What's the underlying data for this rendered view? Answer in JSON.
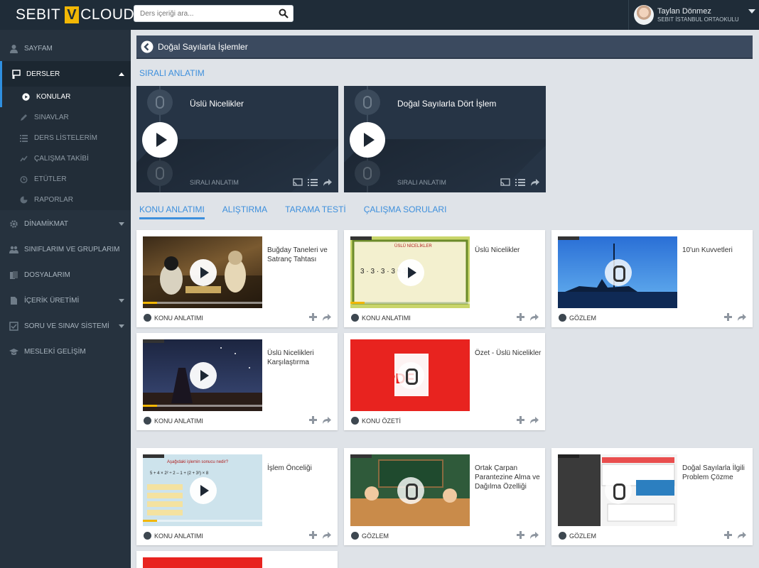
{
  "brand": {
    "left": "SEBIT",
    "v": "V",
    "right": "CLOUD"
  },
  "search": {
    "placeholder": "Ders içeriği ara..."
  },
  "user": {
    "name": "Taylan Dönmez",
    "school": "SEBIT İSTANBUL ORTAOKULU"
  },
  "sidebar": {
    "items": [
      {
        "label": "SAYFAM",
        "icon": "user-icon"
      },
      {
        "label": "DERSLER",
        "icon": "presentation-icon"
      },
      {
        "label": "DİNAMİKMAT",
        "icon": "gear-icon"
      },
      {
        "label": "SINIFLARIM VE GRUPLARIM",
        "icon": "group-icon"
      },
      {
        "label": "DOSYALARIM",
        "icon": "files-icon"
      },
      {
        "label": "İÇERİK ÜRETİMİ",
        "icon": "document-icon"
      },
      {
        "label": "SORU VE SINAV SİSTEMİ",
        "icon": "exam-icon"
      },
      {
        "label": "MESLEKİ GELİŞİM",
        "icon": "graduation-cap-icon"
      }
    ],
    "subitems": [
      {
        "label": "KONULAR",
        "icon": "play-circle-icon"
      },
      {
        "label": "SINAVLAR",
        "icon": "pencil-icon"
      },
      {
        "label": "DERS LİSTELERİM",
        "icon": "list-icon"
      },
      {
        "label": "ÇALIŞMA TAKİBİ",
        "icon": "tracking-icon"
      },
      {
        "label": "ETÜTLER",
        "icon": "clock-icon"
      },
      {
        "label": "RAPORLAR",
        "icon": "pie-chart-icon"
      }
    ]
  },
  "breadcrumb": {
    "title": "Doğal Sayılarla İşlemler"
  },
  "sequential": {
    "heading": "SIRALI ANLATIM",
    "cards": [
      {
        "title": "Üslü Nicelikler",
        "kind": "SIRALI ANLATIM"
      },
      {
        "title": "Doğal Sayılarla Dört İşlem",
        "kind": "SIRALI ANLATIM"
      }
    ]
  },
  "tabs": [
    "KONU ANLATIMI",
    "ALIŞTIRMA",
    "TARAMA TESTİ",
    "ÇALIŞMA SORULARI"
  ],
  "cards": [
    {
      "title": "Buğday Taneleri ve Satranç Tahtası",
      "type": "KONU ANLATIMI"
    },
    {
      "title": "Üslü Nicelikler",
      "type": "KONU ANLATIMI"
    },
    {
      "title": "10'un Kuvvetleri",
      "type": "GÖZLEM"
    },
    {
      "title": "Üslü Nicelikleri Karşılaştırma",
      "type": "KONU ANLATIMI"
    },
    {
      "title": "Özet - Üslü Nicelikler",
      "type": "KONU ÖZETİ"
    },
    {
      "title": "İşlem Önceliği",
      "type": "KONU ANLATIMI"
    },
    {
      "title": "Ortak Çarpan Parantezine Alma ve Dağılma Özelliği",
      "type": "GÖZLEM"
    },
    {
      "title": "Doğal Sayılarla İlgili Problem Çözme",
      "type": "GÖZLEM"
    }
  ],
  "thumb_texts": {
    "uslu_header": "ÜSLÜ NİCELİKLER",
    "uslu_formula": "3 · 3 · 3 · 3 = 3⁴",
    "islem_question": "Aşağıdaki işlemin sonucu nedir?",
    "islem_formula": "5 + 4 × 2² ÷ 2 – 1 + (2 + 3²) × 8",
    "pdf_label": "PDF"
  },
  "colors": {
    "accent": "#3d8fdc",
    "sidebar": "#26323e",
    "topbar": "#1f2c38",
    "crumb": "#3b4a5f"
  }
}
